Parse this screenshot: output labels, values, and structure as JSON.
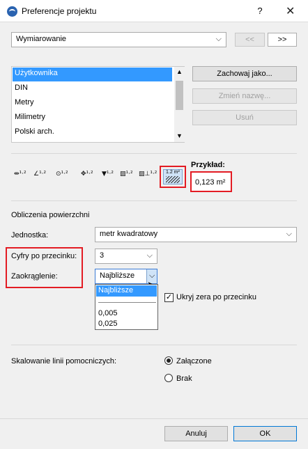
{
  "window": {
    "title": "Preferencje projektu",
    "help_label": "?",
    "close_label": "✕"
  },
  "top": {
    "category_value": "Wymiarowanie",
    "prev_label": "<<",
    "next_label": ">>"
  },
  "presets": {
    "items": [
      "Użytkownika",
      "DIN",
      "Metry",
      "Milimetry",
      "Polski arch."
    ],
    "selected": "Użytkownika",
    "save_as_label": "Zachowaj jako...",
    "rename_label": "Zmień nazwę...",
    "delete_label": "Usuń"
  },
  "dimension_types": {
    "icons": [
      {
        "name": "linear-dimension-icon",
        "glyph": "⇹¹·²"
      },
      {
        "name": "angle-dimension-icon",
        "glyph": "∠¹·²"
      },
      {
        "name": "radius-dimension-icon",
        "glyph": "⊙¹·²"
      },
      {
        "name": "level-dimension-icon",
        "glyph": "✥¹·²"
      },
      {
        "name": "elevation-dimension-icon",
        "glyph": "▼¹·²"
      },
      {
        "name": "door-window-dimension-icon",
        "glyph": "▨¹·²"
      },
      {
        "name": "sill-height-dimension-icon",
        "glyph": "▨⊥¹·²"
      },
      {
        "name": "area-calculation-icon",
        "glyph": "m²"
      }
    ],
    "area_icon_label": "1.2 m²"
  },
  "example": {
    "label": "Przykład:",
    "value": "0,123 m²"
  },
  "area_calc": {
    "section_title": "Obliczenia powierzchni",
    "unit_label": "Jednostka:",
    "unit_value": "metr kwadratowy",
    "decimals_label": "Cyfry po przecinku:",
    "decimals_value": "3",
    "rounding_label": "Zaokrąglenie:",
    "rounding_value": "Najbliższe",
    "rounding_options": [
      "Najbliższe",
      "",
      "0,005",
      "0,025"
    ],
    "hide_zeros_label": "Ukryj zera po przecinku",
    "hide_zeros_checked": true
  },
  "scaling": {
    "label": "Skalowanie linii pomocniczych:",
    "on_label": "Załączone",
    "off_label": "Brak",
    "selected": "Załączone"
  },
  "footer": {
    "cancel_label": "Anuluj",
    "ok_label": "OK"
  },
  "colors": {
    "highlight": "#e31b23",
    "selection": "#3399ff"
  }
}
